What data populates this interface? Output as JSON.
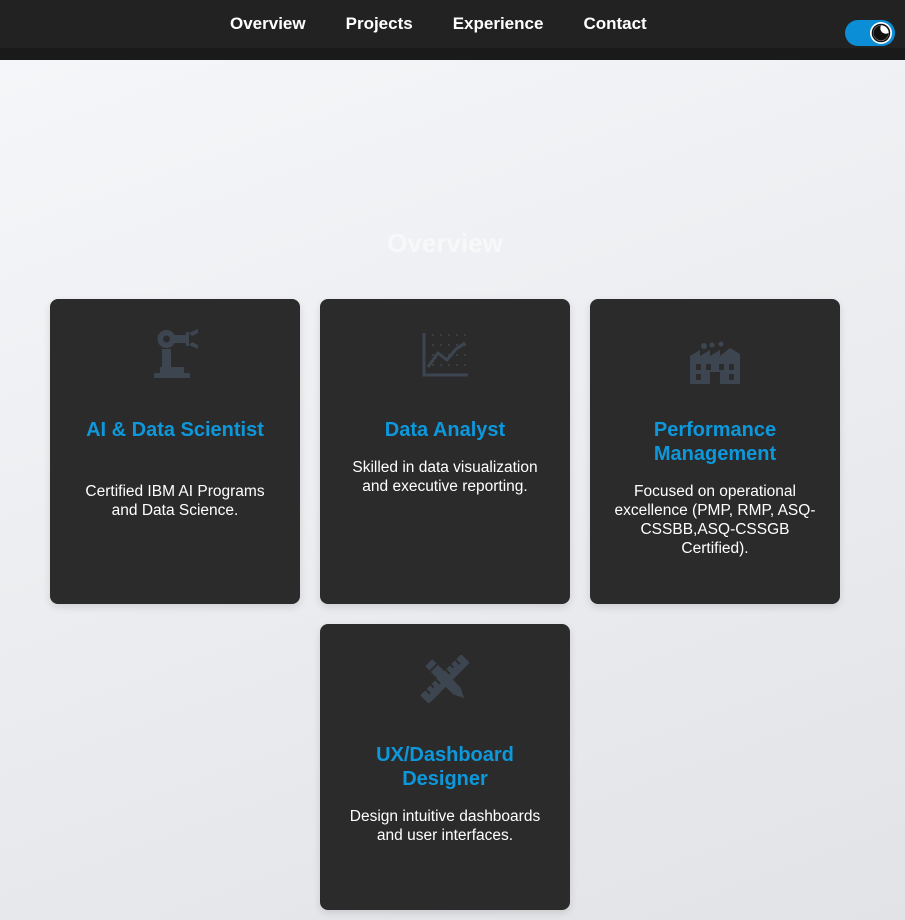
{
  "nav": {
    "links": [
      "Overview",
      "Projects",
      "Experience",
      "Contact"
    ],
    "theme_toggle": {
      "state": "on",
      "icon": "moon-icon"
    }
  },
  "section": {
    "title": "Overview"
  },
  "cards": [
    {
      "icon": "robot-arm-icon",
      "title": "AI & Data Scientist",
      "text": "Certified IBM AI Programs and Data Science."
    },
    {
      "icon": "line-chart-icon",
      "title": "Data Analyst",
      "text": "Skilled in data visualization and executive reporting."
    },
    {
      "icon": "industry-icon",
      "title": "Performance Management",
      "text": "Focused on operational excellence (PMP, RMP, ASQ-CSSBB,ASQ-CSSGB Certified)."
    },
    {
      "icon": "ruler-pencil-icon",
      "title": "UX/Dashboard Designer",
      "text": "Design intuitive dashboards and user interfaces."
    }
  ],
  "colors": {
    "accent": "#0d98dc",
    "card_bg": "#2b2b2b",
    "nav_bg": "#222222",
    "icon": "#3d4650"
  }
}
